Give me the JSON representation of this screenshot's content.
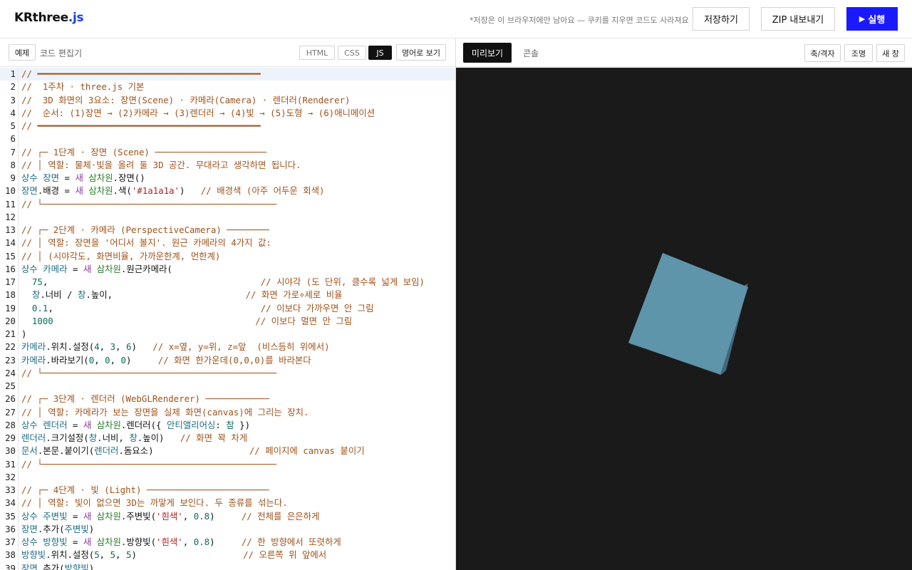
{
  "app": {
    "logo_main": "KRthree",
    "logo_accent": ".js"
  },
  "header": {
    "note": "*저장은 이 브라우저에만 남아요 — 쿠키를 지우면 코드도 사라져요",
    "save_label": "저장하기",
    "zip_label": "ZIP 내보내기",
    "run_label": "실행",
    "run_icon": "play-icon"
  },
  "editor": {
    "example_label": "예제",
    "title": "코드 편집기",
    "tabs": [
      "HTML",
      "CSS",
      "JS"
    ],
    "active_tab": "JS",
    "english_label": "영어로 보기"
  },
  "preview": {
    "tabs": [
      "미리보기",
      "콘솔"
    ],
    "active_tab": "미리보기",
    "axes_label": "축/격자",
    "light_label": "조명",
    "new_window_label": "새 창",
    "background": "#1a1a1a",
    "cube_color": "#5f95ab"
  },
  "code_lines": [
    {
      "n": "1",
      "segs": [
        [
          "c",
          "// ━━━━━━━━━━━━━━━━━━━━━━━━━━━━━━━━━━━━━━━━━━"
        ]
      ]
    },
    {
      "n": "2",
      "segs": [
        [
          "c",
          "//  1주차 · three.js 기본"
        ]
      ]
    },
    {
      "n": "3",
      "segs": [
        [
          "c",
          "//  3D 화면의 3요소: 장면(Scene) · 카메라(Camera) · 렌더러(Renderer)"
        ]
      ]
    },
    {
      "n": "4",
      "segs": [
        [
          "c",
          "//  순서: (1)장면 → (2)카메라 → (3)렌더러 → (4)빛 → (5)도형 → (6)애니메이션"
        ]
      ]
    },
    {
      "n": "5",
      "segs": [
        [
          "c",
          "// ━━━━━━━━━━━━━━━━━━━━━━━━━━━━━━━━━━━━━━━━━━"
        ]
      ]
    },
    {
      "n": "6",
      "segs": []
    },
    {
      "n": "7",
      "segs": [
        [
          "c",
          "// ┌─ 1단계 · 장면 (Scene) ─────────────────────"
        ]
      ]
    },
    {
      "n": "8",
      "segs": [
        [
          "c",
          "// │ 역할: 물체·빛을 올려 둘 3D 공간. 무대라고 생각하면 됩니다."
        ]
      ]
    },
    {
      "n": "9",
      "segs": [
        [
          "k",
          "상수 "
        ],
        [
          "v",
          "장면"
        ],
        [
          "p",
          " = "
        ],
        [
          "n",
          "새 "
        ],
        [
          "g",
          "삼차원"
        ],
        [
          "p",
          ".장면()"
        ]
      ]
    },
    {
      "n": "10",
      "segs": [
        [
          "v",
          "장면"
        ],
        [
          "p",
          ".배경 = "
        ],
        [
          "n",
          "새 "
        ],
        [
          "g",
          "삼차원"
        ],
        [
          "p",
          ".색("
        ],
        [
          "s",
          "'#1a1a1a'"
        ],
        [
          "p",
          ")   "
        ],
        [
          "c",
          "// 배경색 (아주 어두운 회색)"
        ]
      ]
    },
    {
      "n": "11",
      "segs": [
        [
          "c",
          "// └────────────────────────────────────────────"
        ]
      ]
    },
    {
      "n": "12",
      "segs": []
    },
    {
      "n": "13",
      "segs": [
        [
          "c",
          "// ┌─ 2단계 · 카메라 (PerspectiveCamera) ────────"
        ]
      ]
    },
    {
      "n": "14",
      "segs": [
        [
          "c",
          "// │ 역할: 장면을 '어디서 볼지'. 원근 카메라의 4가지 값:"
        ]
      ]
    },
    {
      "n": "15",
      "segs": [
        [
          "c",
          "// │ (시야각도, 화면비율, 가까운한계, 먼한계)"
        ]
      ]
    },
    {
      "n": "16",
      "segs": [
        [
          "k",
          "상수 "
        ],
        [
          "v",
          "카메라"
        ],
        [
          "p",
          " = "
        ],
        [
          "n",
          "새 "
        ],
        [
          "g",
          "삼차원"
        ],
        [
          "p",
          ".원근카메라("
        ]
      ]
    },
    {
      "n": "17",
      "segs": [
        [
          "num",
          "  75"
        ],
        [
          "p",
          ",                                        "
        ],
        [
          "c",
          "// 시야각 (도 단위, 클수록 넓게 보임)"
        ]
      ]
    },
    {
      "n": "18",
      "segs": [
        [
          "p",
          "  "
        ],
        [
          "v",
          "창"
        ],
        [
          "p",
          ".너비 / "
        ],
        [
          "v",
          "창"
        ],
        [
          "p",
          ".높이,                         "
        ],
        [
          "c",
          "// 화면 가로÷세로 비율"
        ]
      ]
    },
    {
      "n": "19",
      "segs": [
        [
          "num",
          "  0.1"
        ],
        [
          "p",
          ",                                       "
        ],
        [
          "c",
          "// 이보다 가까우면 안 그림"
        ]
      ]
    },
    {
      "n": "20",
      "segs": [
        [
          "num",
          "  1000"
        ],
        [
          "p",
          "                                      "
        ],
        [
          "c",
          "// 이보다 멀면 안 그림"
        ]
      ]
    },
    {
      "n": "21",
      "segs": [
        [
          "p",
          ")"
        ]
      ]
    },
    {
      "n": "22",
      "segs": [
        [
          "v",
          "카메라"
        ],
        [
          "p",
          ".위치.설정("
        ],
        [
          "num",
          "4"
        ],
        [
          "p",
          ", "
        ],
        [
          "num",
          "3"
        ],
        [
          "p",
          ", "
        ],
        [
          "num",
          "6"
        ],
        [
          "p",
          ")   "
        ],
        [
          "c",
          "// x=옆, y=위, z=앞  (비스듬히 위에서)"
        ]
      ]
    },
    {
      "n": "23",
      "segs": [
        [
          "v",
          "카메라"
        ],
        [
          "p",
          ".바라보기("
        ],
        [
          "num",
          "0"
        ],
        [
          "p",
          ", "
        ],
        [
          "num",
          "0"
        ],
        [
          "p",
          ", "
        ],
        [
          "num",
          "0"
        ],
        [
          "p",
          ")     "
        ],
        [
          "c",
          "// 화면 한가운데(0,0,0)를 바라본다"
        ]
      ]
    },
    {
      "n": "24",
      "segs": [
        [
          "c",
          "// └────────────────────────────────────────────"
        ]
      ]
    },
    {
      "n": "25",
      "segs": []
    },
    {
      "n": "26",
      "segs": [
        [
          "c",
          "// ┌─ 3단계 · 렌더러 (WebGLRenderer) ────────────"
        ]
      ]
    },
    {
      "n": "27",
      "segs": [
        [
          "c",
          "// │ 역할: 카메라가 보는 장면을 실제 화면(canvas)에 그리는 장치."
        ]
      ]
    },
    {
      "n": "28",
      "segs": [
        [
          "k",
          "상수 "
        ],
        [
          "v",
          "렌더러"
        ],
        [
          "p",
          " = "
        ],
        [
          "n",
          "새 "
        ],
        [
          "g",
          "삼차원"
        ],
        [
          "p",
          ".렌더러({ "
        ],
        [
          "k",
          "안티앨리어싱"
        ],
        [
          "p",
          ": "
        ],
        [
          "num",
          "참"
        ],
        [
          "p",
          " })"
        ]
      ]
    },
    {
      "n": "29",
      "segs": [
        [
          "v",
          "렌더러"
        ],
        [
          "p",
          ".크기설정("
        ],
        [
          "v",
          "창"
        ],
        [
          "p",
          ".너비, "
        ],
        [
          "v",
          "창"
        ],
        [
          "p",
          ".높이)   "
        ],
        [
          "c",
          "// 화면 꽉 차게"
        ]
      ]
    },
    {
      "n": "30",
      "segs": [
        [
          "v",
          "문서"
        ],
        [
          "p",
          ".본문.붙이기("
        ],
        [
          "v",
          "렌더러"
        ],
        [
          "p",
          ".돔요소)                  "
        ],
        [
          "c",
          "// 페이지에 canvas 붙이기"
        ]
      ]
    },
    {
      "n": "31",
      "segs": [
        [
          "c",
          "// └────────────────────────────────────────────"
        ]
      ]
    },
    {
      "n": "32",
      "segs": []
    },
    {
      "n": "33",
      "segs": [
        [
          "c",
          "// ┌─ 4단계 · 빛 (Light) ───────────────────────"
        ]
      ]
    },
    {
      "n": "34",
      "segs": [
        [
          "c",
          "// │ 역할: 빛이 없으면 3D는 까맣게 보인다. 두 종류를 섞는다."
        ]
      ]
    },
    {
      "n": "35",
      "segs": [
        [
          "k",
          "상수 "
        ],
        [
          "v",
          "주변빛"
        ],
        [
          "p",
          " = "
        ],
        [
          "n",
          "새 "
        ],
        [
          "g",
          "삼차원"
        ],
        [
          "p",
          ".주변빛("
        ],
        [
          "s",
          "'흰색'"
        ],
        [
          "p",
          ", "
        ],
        [
          "num",
          "0.8"
        ],
        [
          "p",
          ")     "
        ],
        [
          "c",
          "// 전체를 은은하게"
        ]
      ]
    },
    {
      "n": "36",
      "segs": [
        [
          "v",
          "장면"
        ],
        [
          "p",
          ".추가("
        ],
        [
          "v",
          "주변빛"
        ],
        [
          "p",
          ")"
        ]
      ]
    },
    {
      "n": "37",
      "segs": [
        [
          "k",
          "상수 "
        ],
        [
          "v",
          "방향빛"
        ],
        [
          "p",
          " = "
        ],
        [
          "n",
          "새 "
        ],
        [
          "g",
          "삼차원"
        ],
        [
          "p",
          ".방향빛("
        ],
        [
          "s",
          "'흰색'"
        ],
        [
          "p",
          ", "
        ],
        [
          "num",
          "0.8"
        ],
        [
          "p",
          ")     "
        ],
        [
          "c",
          "// 한 방향에서 또렷하게"
        ]
      ]
    },
    {
      "n": "38",
      "segs": [
        [
          "v",
          "방향빛"
        ],
        [
          "p",
          ".위치.설정("
        ],
        [
          "num",
          "5"
        ],
        [
          "p",
          ", "
        ],
        [
          "num",
          "5"
        ],
        [
          "p",
          ", "
        ],
        [
          "num",
          "5"
        ],
        [
          "p",
          ")                    "
        ],
        [
          "c",
          "// 오른쪽 위 앞에서"
        ]
      ]
    },
    {
      "n": "39",
      "segs": [
        [
          "v",
          "장면"
        ],
        [
          "p",
          ".추가("
        ],
        [
          "v",
          "방향빛"
        ],
        [
          "p",
          ")"
        ]
      ]
    }
  ]
}
